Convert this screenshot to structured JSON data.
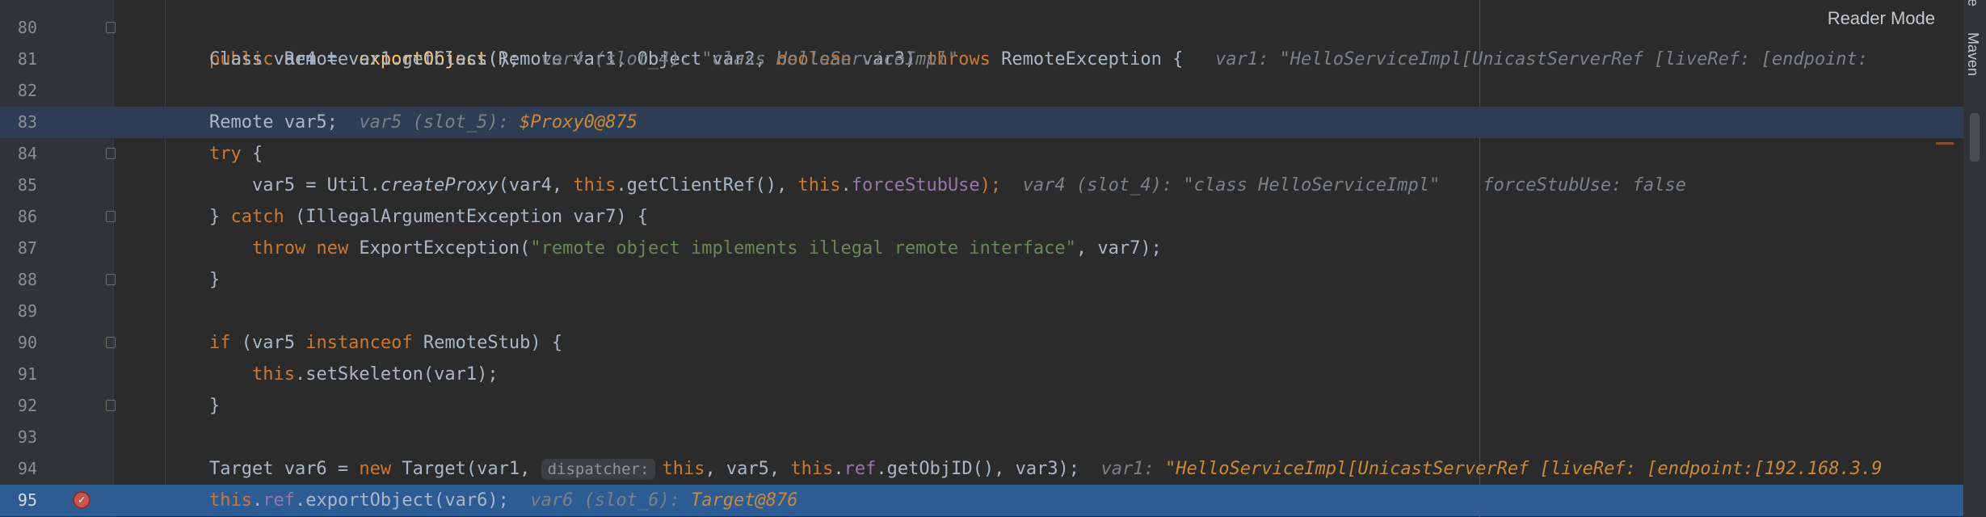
{
  "toolbar": {
    "reader_mode": "Reader Mode"
  },
  "sidebar": {
    "tool_windows": [
      "ase",
      "Maven"
    ]
  },
  "lines": [
    {
      "n": "80"
    },
    {
      "n": "81"
    },
    {
      "n": "82"
    },
    {
      "n": "83"
    },
    {
      "n": "84"
    },
    {
      "n": "85"
    },
    {
      "n": "86"
    },
    {
      "n": "87"
    },
    {
      "n": "88"
    },
    {
      "n": "89"
    },
    {
      "n": "90"
    },
    {
      "n": "91"
    },
    {
      "n": "92"
    },
    {
      "n": "93"
    },
    {
      "n": "94"
    },
    {
      "n": "95"
    }
  ],
  "code": {
    "l80": {
      "public": "public ",
      "type1": "Remote ",
      "method": "exportObject",
      "paren": "(",
      "params": "Remote var1, Object var2, ",
      "boolean": "boolean",
      "params2": " var3) ",
      "throws": "throws",
      "exc": " RemoteException {",
      "inlay": "var1: \"HelloServiceImpl[UnicastServerRef [liveRef: [endpoint:"
    },
    "l81": {
      "text": "Class var4 = var1.getClass();",
      "inlay": "var4 (slot_4): \"class HelloServiceImpl\""
    },
    "l83": {
      "text": "Remote var5;",
      "inlay": "var5 (slot_5): ",
      "inlay_val": "$Proxy0@875"
    },
    "l84": {
      "kw": "try",
      "rest": " {"
    },
    "l85": {
      "a": "var5 = Util.",
      "b": "createProxy",
      "c": "(var4, ",
      "this1": "this",
      "d": ".getClientRef(), ",
      "this2": "this",
      "e": ".",
      "field": "forceStubUse",
      "f": ");",
      "inlay1": "var4 (slot_4): \"class HelloServiceImpl\"",
      "inlay2": "forceStubUse: false"
    },
    "l86": {
      "a": "} ",
      "kw": "catch",
      "b": " (IllegalArgumentException var7) {"
    },
    "l87": {
      "throw": "throw",
      "new": " new",
      "a": " ExportException(",
      "str": "\"remote object implements illegal remote interface\"",
      "b": ", var7);"
    },
    "l88": {
      "text": "}"
    },
    "l90": {
      "kw": "if",
      "a": " (var5 ",
      "kw2": "instanceof",
      "b": " RemoteStub) {"
    },
    "l91": {
      "this": "this",
      "a": ".setSkeleton(var1);"
    },
    "l92": {
      "text": "}"
    },
    "l94": {
      "a": "Target var6 = ",
      "new": "new",
      "b": " Target(var1, ",
      "hint": "dispatcher:",
      "this1": "this",
      "c": ", var5, ",
      "this2": "this",
      "d": ".",
      "field": "ref",
      "e": ".getObjID(), var3);",
      "inlay": "var1: ",
      "inlay_val": "\"HelloServiceImpl[UnicastServerRef [liveRef: [endpoint:[192.168.3.9"
    },
    "l95": {
      "this": "this",
      "a": ".",
      "field": "ref",
      "b": ".exportObject(var6);",
      "inlay": "var6 (slot_6): ",
      "inlay_val": "Target@876"
    }
  }
}
